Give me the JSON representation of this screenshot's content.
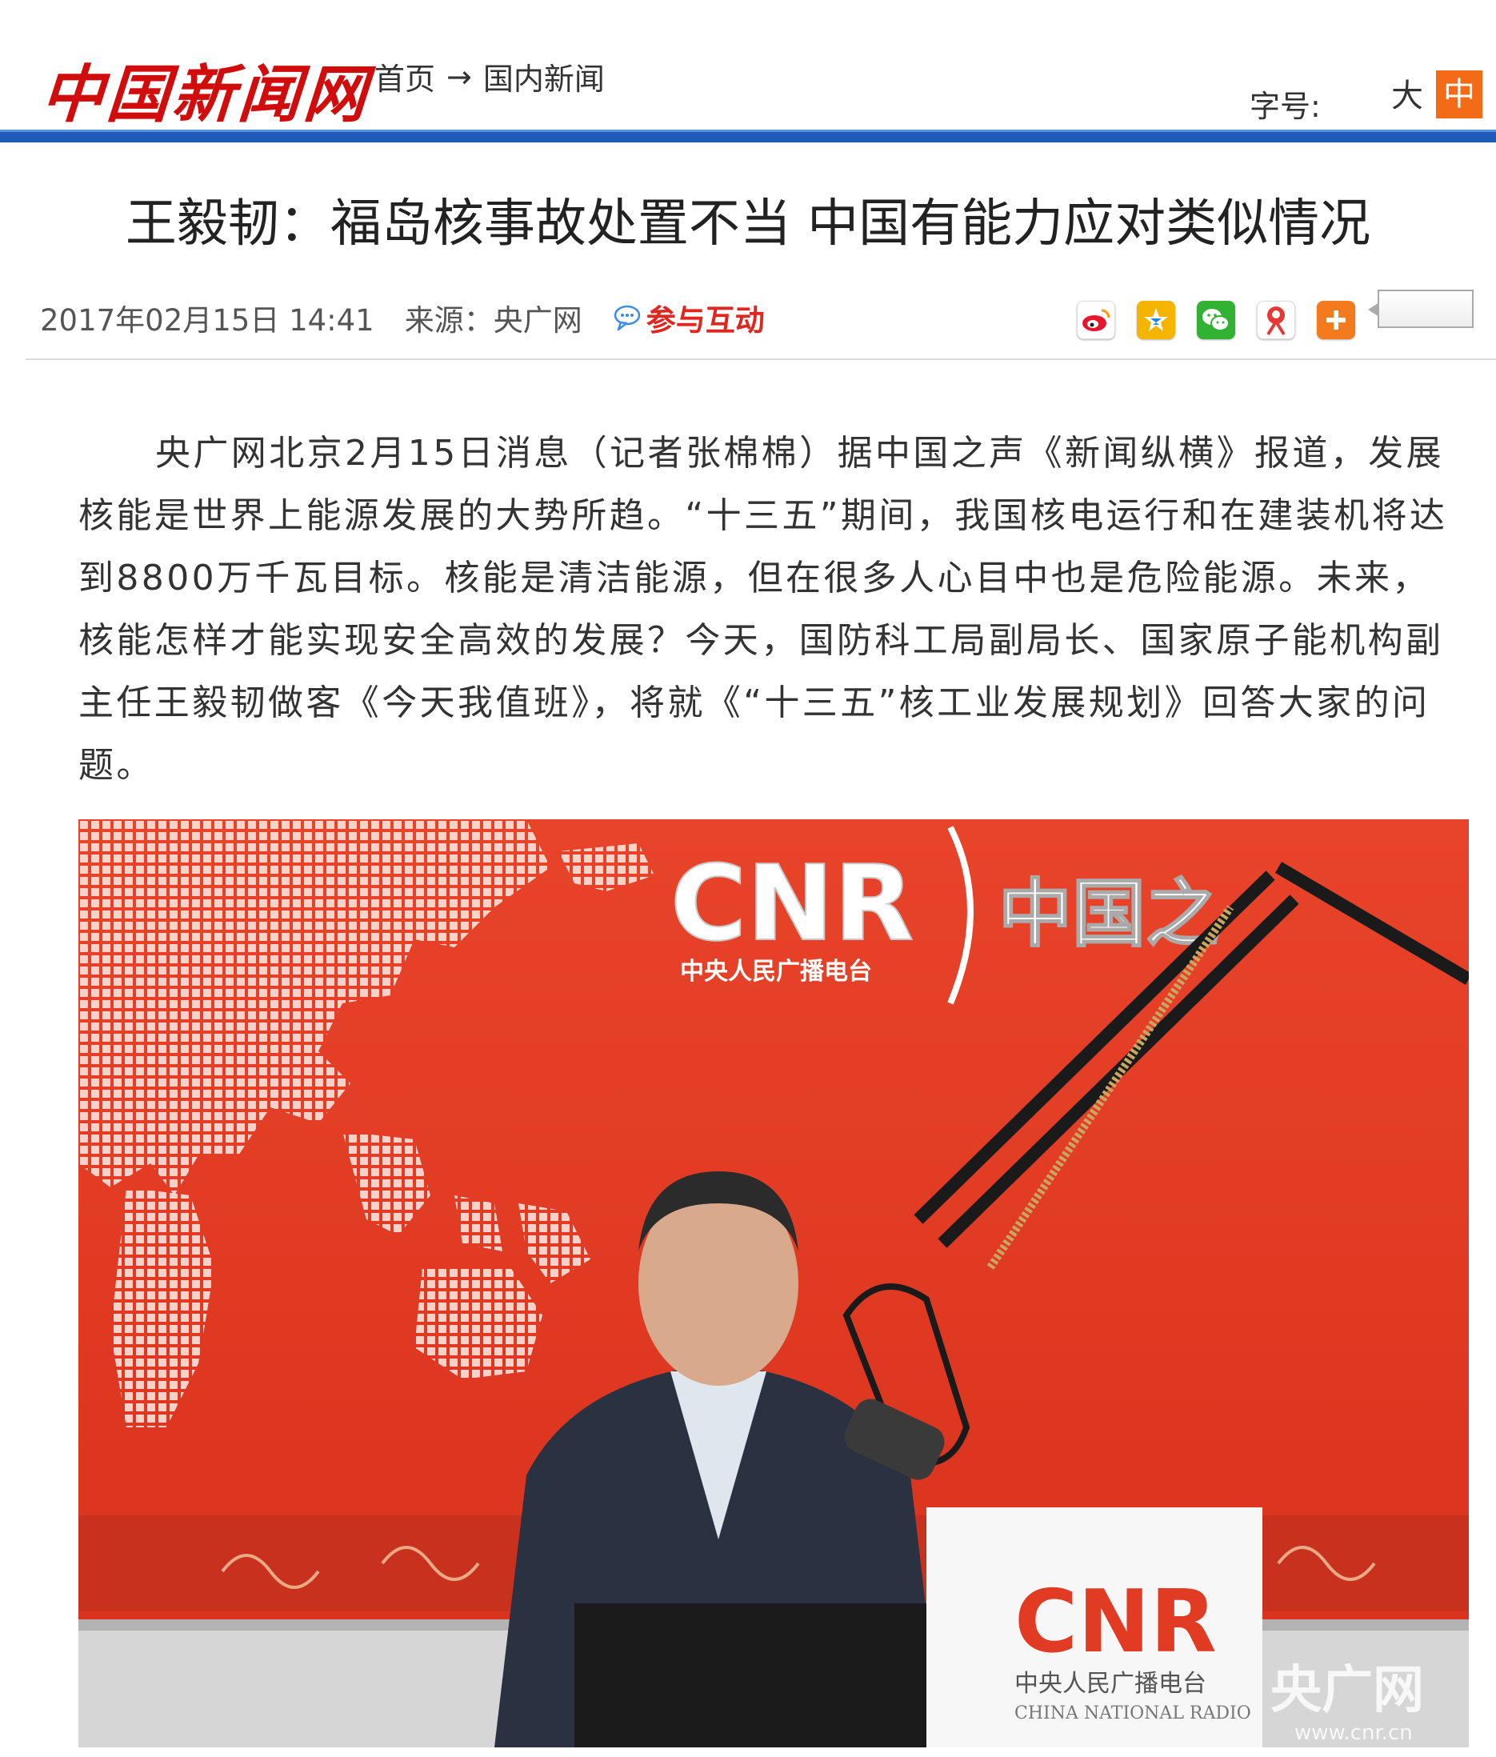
{
  "header": {
    "logo_text": "中国新闻网",
    "breadcrumb": [
      "首页",
      "国内新闻"
    ],
    "breadcrumb_separator": "→",
    "font_size_label": "字号:",
    "font_large": "大",
    "font_medium": "中",
    "accent_color": "#f36b16",
    "rule_color": "#1e5bb8"
  },
  "article": {
    "title": "王毅韧：福岛核事故处置不当 中国有能力应对类似情况",
    "date": "2017年02月15日 14:41",
    "source": "来源：央广网",
    "interact_label": "参与互动",
    "paragraph": "央广网北京2月15日消息（记者张棉棉）据中国之声《新闻纵横》报道，发展核能是世界上能源发展的大势所趋。“十三五”期间，我国核电运行和在建装机将达到8800万千瓦目标。核能是清洁能源，但在很多人心目中也是危险能源。未来，核能怎样才能实现安全高效的发展？今天，国防科工局副局长、国家原子能机构副主任王毅韧做客《今天我值班》，将就《“十三五”核工业发展规划》回答大家的问题。"
  },
  "share": {
    "icons": [
      "weibo-icon",
      "qzone-icon",
      "wechat-icon",
      "renren-icon",
      "more-icon"
    ]
  },
  "photo": {
    "brand_main": "CNR",
    "brand_sub": "中央人民广播电台",
    "studio_sign": "中国之",
    "desk_sub": "中央人民广播电台",
    "desk_sub_en": "CHINA NATIONAL RADIO",
    "watermark": "央广网",
    "watermark_url": "www.cnr.cn"
  }
}
